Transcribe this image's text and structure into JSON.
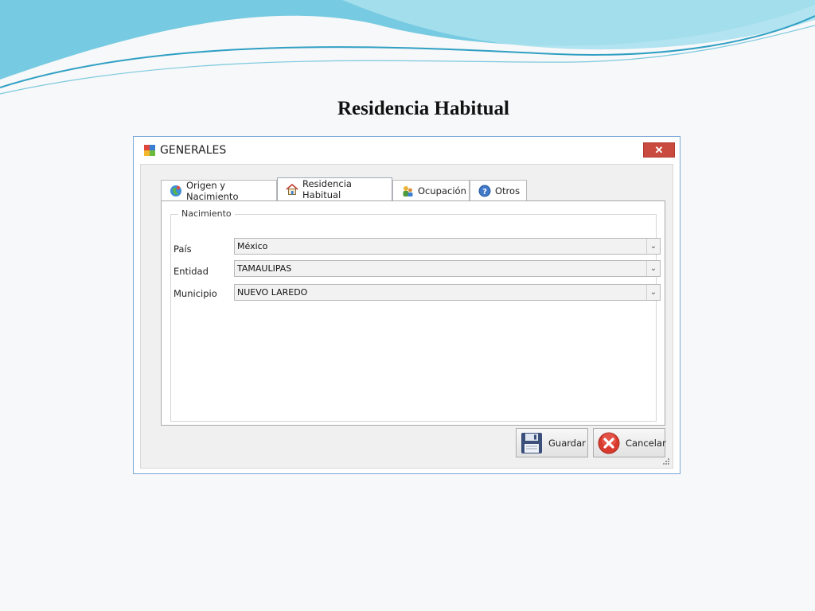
{
  "slide": {
    "title": "Residencia Habitual"
  },
  "window": {
    "title": "GENERALES",
    "close_glyph": "✕"
  },
  "tabs": [
    {
      "label": "Origen y Nacimiento",
      "icon": "globe-icon"
    },
    {
      "label": "Residencia Habitual",
      "icon": "house-icon",
      "active": true
    },
    {
      "label": "Ocupación",
      "icon": "workers-icon"
    },
    {
      "label": "Otros",
      "icon": "help-circle-icon"
    }
  ],
  "group": {
    "legend": "Nacimiento"
  },
  "fields": {
    "pais": {
      "label": "País",
      "value": "México"
    },
    "entidad": {
      "label": "Entidad",
      "value": "TAMAULIPAS"
    },
    "municipio": {
      "label": "Municipio",
      "value": "NUEVO LAREDO"
    }
  },
  "buttons": {
    "save": {
      "label": "Guardar",
      "icon": "floppy-disk-icon"
    },
    "cancel": {
      "label": "Cancelar",
      "icon": "cancel-x-icon"
    }
  },
  "colors": {
    "wave_blue": "#4bb8d6",
    "window_border": "#7aa7d6",
    "close_red": "#c94a3f"
  }
}
